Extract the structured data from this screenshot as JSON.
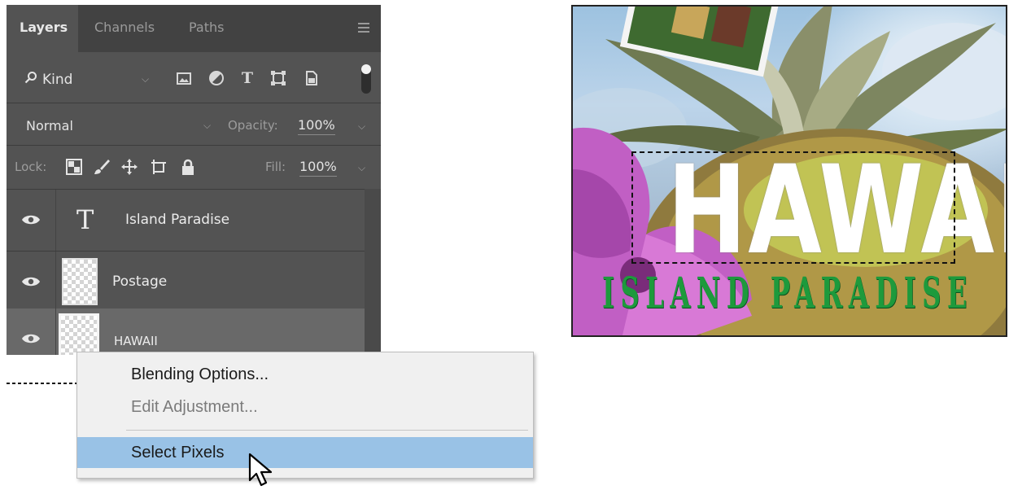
{
  "panel": {
    "tabs": [
      {
        "label": "Layers",
        "active": true
      },
      {
        "label": "Channels",
        "active": false
      },
      {
        "label": "Paths",
        "active": false
      }
    ],
    "filter": {
      "kind_label": "Kind",
      "icons": [
        "image-filter-icon",
        "adjustment-filter-icon",
        "type-filter-icon",
        "shape-filter-icon",
        "smart-object-filter-icon"
      ]
    },
    "blend_mode": "Normal",
    "opacity_label": "Opacity:",
    "opacity_value": "100%",
    "lock_label": "Lock:",
    "fill_label": "Fill:",
    "fill_value": "100%",
    "layers": [
      {
        "name": "Island Paradise",
        "type": "text",
        "visible": true,
        "selected": false
      },
      {
        "name": "Postage",
        "type": "pixel",
        "visible": true,
        "selected": false
      },
      {
        "name": "HAWAII",
        "type": "pixel",
        "visible": true,
        "selected": true
      }
    ]
  },
  "context_menu": {
    "items": [
      {
        "label": "Blending Options...",
        "enabled": true,
        "highlighted": false
      },
      {
        "label": "Edit Adjustment...",
        "enabled": false,
        "highlighted": false
      },
      {
        "label": "Select Pixels",
        "enabled": true,
        "highlighted": true
      }
    ]
  },
  "artwork": {
    "title_text": "HAWAII",
    "subtitle_text": "ISLAND PARADISE"
  },
  "colors": {
    "panel_bg": "#535353",
    "tabbar_bg": "#424242",
    "selected_layer": "#696969",
    "menu_highlight": "#99c2e6",
    "subtitle_green": "#1d9a3c"
  }
}
